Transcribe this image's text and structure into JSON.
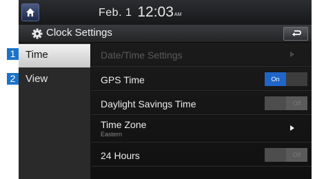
{
  "status_bar": {
    "date": "Feb. 1",
    "time": "12:03",
    "ampm": "AM"
  },
  "title_bar": {
    "title": "Clock Settings"
  },
  "sidebar": {
    "items": [
      {
        "label": "Time",
        "active": true
      },
      {
        "label": "View",
        "active": false
      }
    ]
  },
  "callouts": [
    "1",
    "2"
  ],
  "settings": {
    "datetime": {
      "label": "Date/Time Settings",
      "enabled": false
    },
    "gps_time": {
      "label": "GPS Time",
      "state": "On",
      "value": true
    },
    "dst": {
      "label": "Daylight Savings Time",
      "state": "Off",
      "value": false
    },
    "timezone": {
      "label": "Time Zone",
      "value": "Eastern"
    },
    "hours24": {
      "label": "24 Hours",
      "state": "Off",
      "value": false
    }
  },
  "toggle_labels": {
    "on": "On",
    "off": "Off"
  },
  "icons": {
    "home": "home-icon",
    "gear": "gear-icon",
    "back": "back-icon",
    "chevron": "chevron-right-icon"
  },
  "colors": {
    "accent": "#1f66c7",
    "callout": "#1a73c9"
  }
}
